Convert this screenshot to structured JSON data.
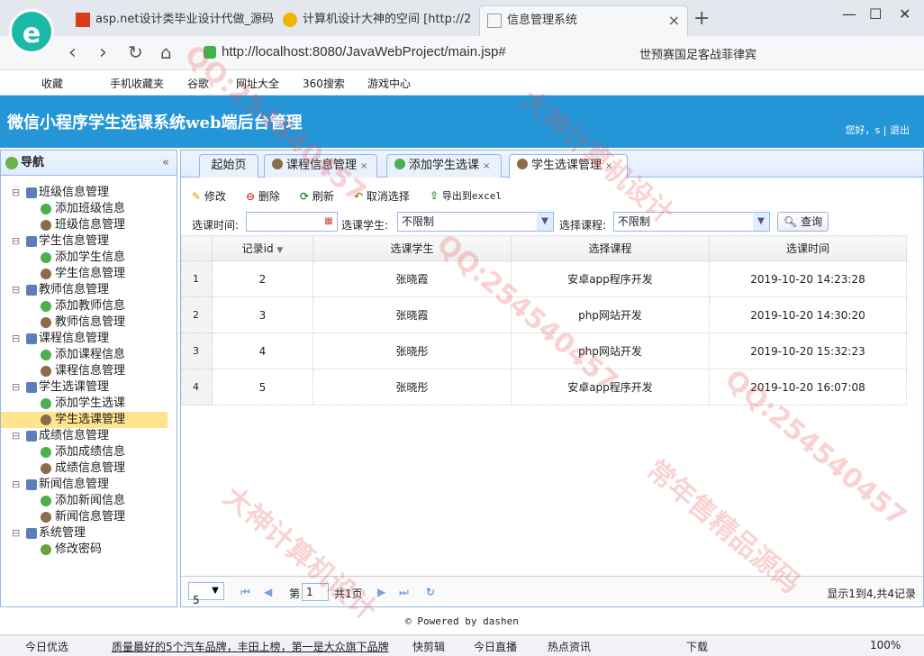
{
  "browser": {
    "logo": "e",
    "tabs": [
      {
        "label": "asp.net设计类毕业设计代做_源码",
        "icon_color": "#d83c1f"
      },
      {
        "label": "计算机设计大神的空间 [http://2",
        "icon_color": "#f0b400"
      },
      {
        "label": "信息管理系统",
        "icon_color": "#999999"
      }
    ],
    "url": "http://localhost:8080/JavaWebProject/main.jsp#",
    "search_hint": "世预赛国足客战菲律宾",
    "bookmarks": [
      "收藏",
      "手机收藏夹",
      "谷歌",
      "网址大全",
      "360搜索",
      "游戏中心"
    ]
  },
  "header": {
    "title": "微信小程序学生选课系统web端后台管理",
    "user": "您好，s | 退出"
  },
  "nav": {
    "title": "导航",
    "collapse": "«",
    "groups": [
      {
        "label": "班级信息管理",
        "items": [
          "添加班级信息",
          "班级信息管理"
        ]
      },
      {
        "label": "学生信息管理",
        "items": [
          "添加学生信息",
          "学生信息管理"
        ]
      },
      {
        "label": "教师信息管理",
        "items": [
          "添加教师信息",
          "教师信息管理"
        ]
      },
      {
        "label": "课程信息管理",
        "items": [
          "添加课程信息",
          "课程信息管理"
        ]
      },
      {
        "label": "学生选课管理",
        "items": [
          "添加学生选课",
          "学生选课管理"
        ]
      },
      {
        "label": "成绩信息管理",
        "items": [
          "添加成绩信息",
          "成绩信息管理"
        ]
      },
      {
        "label": "新闻信息管理",
        "items": [
          "添加新闻信息",
          "新闻信息管理"
        ]
      },
      {
        "label": "系统管理",
        "items": [
          "修改密码"
        ]
      }
    ]
  },
  "tabs": [
    "起始页",
    "课程信息管理",
    "添加学生选课",
    "学生选课管理"
  ],
  "toolbar": {
    "edit": "修改",
    "delete": "删除",
    "refresh": "刷新",
    "cancel": "取消选择",
    "export": "导出到excel"
  },
  "filters": {
    "time_label": "选课时间:",
    "student_label": "选课学生:",
    "student_value": "不限制",
    "course_label": "选择课程:",
    "course_value": "不限制",
    "query": "查询"
  },
  "grid": {
    "headers": [
      "记录id",
      "选课学生",
      "选择课程",
      "选课时间"
    ],
    "rows": [
      {
        "rn": "1",
        "id": "2",
        "student": "张晓霞",
        "course": "安卓app程序开发",
        "time": "2019-10-20 14:23:28"
      },
      {
        "rn": "2",
        "id": "3",
        "student": "张晓霞",
        "course": "php网站开发",
        "time": "2019-10-20 14:30:20"
      },
      {
        "rn": "3",
        "id": "4",
        "student": "张晓彤",
        "course": "php网站开发",
        "time": "2019-10-20 15:32:23"
      },
      {
        "rn": "4",
        "id": "5",
        "student": "张晓彤",
        "course": "安卓app程序开发",
        "time": "2019-10-20 16:07:08"
      }
    ]
  },
  "pager": {
    "size": "5",
    "page_label": "第",
    "page": "1",
    "total_pages": "共1页",
    "summary": "显示1到4,共4记录"
  },
  "footer": "© Powered by dashen",
  "status": {
    "left": "今日优选",
    "news": "质量最好的5个汽车品牌，丰田上榜，第一是大众旗下品牌",
    "items": [
      "快剪辑",
      "今日直播",
      "热点资讯",
      "下载",
      "100%"
    ]
  },
  "watermarks": [
    "QQ:254540457",
    "大神计算机设计",
    "常年售精品源码"
  ]
}
